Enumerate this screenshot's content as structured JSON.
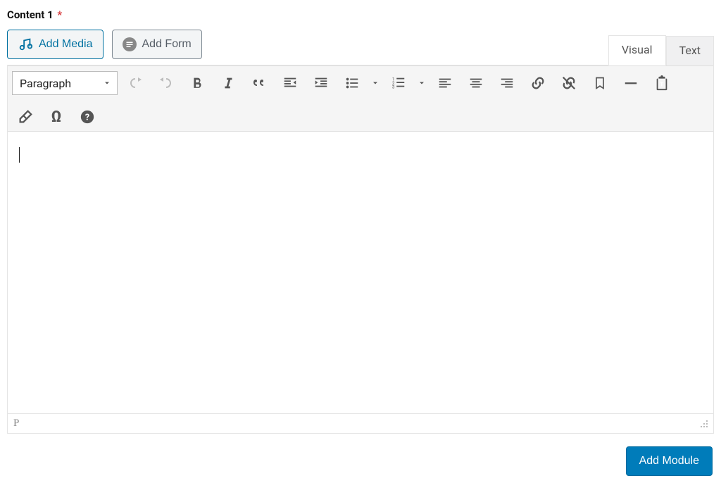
{
  "field": {
    "label": "Content 1",
    "required_mark": "*"
  },
  "buttons": {
    "add_media": "Add Media",
    "add_form": "Add Form",
    "add_module": "Add Module"
  },
  "tabs": {
    "visual": "Visual",
    "text": "Text"
  },
  "toolbar": {
    "format_select": "Paragraph"
  },
  "statusbar": {
    "path": "P"
  }
}
